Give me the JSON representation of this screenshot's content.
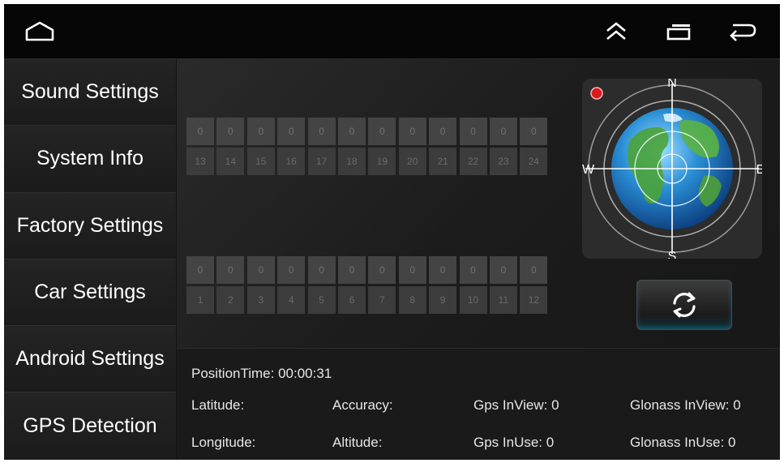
{
  "nav": {
    "icons": [
      "home-icon",
      "double-chevron-up-icon",
      "recent-apps-icon",
      "back-icon"
    ]
  },
  "sidebar": {
    "items": [
      {
        "label": "Sound Settings"
      },
      {
        "label": "System Info"
      },
      {
        "label": "Factory Settings"
      },
      {
        "label": "Car Settings"
      },
      {
        "label": "Android Settings"
      },
      {
        "label": "GPS Detection"
      }
    ]
  },
  "satellites": {
    "upper": {
      "values": [
        "0",
        "0",
        "0",
        "0",
        "0",
        "0",
        "0",
        "0",
        "0",
        "0",
        "0",
        "0"
      ],
      "ids": [
        "13",
        "14",
        "15",
        "16",
        "17",
        "18",
        "19",
        "20",
        "21",
        "22",
        "23",
        "24"
      ]
    },
    "lower": {
      "values": [
        "0",
        "0",
        "0",
        "0",
        "0",
        "0",
        "0",
        "0",
        "0",
        "0",
        "0",
        "0"
      ],
      "ids": [
        "1",
        "2",
        "3",
        "4",
        "5",
        "6",
        "7",
        "8",
        "9",
        "10",
        "11",
        "12"
      ]
    }
  },
  "compass": {
    "n": "N",
    "e": "E",
    "s": "S",
    "w": "W"
  },
  "info": {
    "position_time": "PositionTime: 00:00:31",
    "latitude": "Latitude:",
    "longitude": "Longitude:",
    "accuracy": "Accuracy:",
    "altitude": "Altitude:",
    "gps_inview": "Gps InView: 0",
    "gps_inuse": "Gps InUse: 0",
    "glonass_inview": "Glonass InView: 0",
    "glonass_inuse": "Glonass InUse: 0"
  },
  "colors": {
    "accent_cyan": "#22b8d8",
    "status_dot": "#d81a1a"
  }
}
